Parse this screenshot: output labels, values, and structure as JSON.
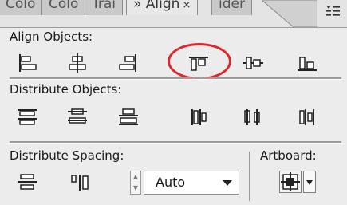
{
  "tabs": [
    {
      "label": "Colo"
    },
    {
      "label": "Colo"
    },
    {
      "label": "Trai"
    },
    {
      "label": "» Align",
      "close": "×",
      "active": true
    },
    {
      "label": "ider"
    }
  ],
  "panel_menu_icon": "panel-menu-icon",
  "align_objects": {
    "label": "Align Objects:",
    "buttons": [
      {
        "name": "horizontal-align-left"
      },
      {
        "name": "horizontal-align-center"
      },
      {
        "name": "horizontal-align-right"
      },
      {
        "name": "vertical-align-top",
        "highlighted": true
      },
      {
        "name": "vertical-align-center"
      },
      {
        "name": "vertical-align-bottom"
      }
    ]
  },
  "distribute_objects": {
    "label": "Distribute Objects:",
    "buttons": [
      {
        "name": "vertical-distribute-top"
      },
      {
        "name": "vertical-distribute-center"
      },
      {
        "name": "vertical-distribute-bottom"
      },
      {
        "name": "horizontal-distribute-left"
      },
      {
        "name": "horizontal-distribute-center"
      },
      {
        "name": "horizontal-distribute-right"
      }
    ]
  },
  "distribute_spacing": {
    "label": "Distribute Spacing:",
    "buttons": [
      {
        "name": "vertical-distribute-space"
      },
      {
        "name": "horizontal-distribute-space"
      }
    ],
    "value": "Auto"
  },
  "artboard": {
    "label": "Artboard:"
  },
  "colors": {
    "highlight_circle": "#e0262a",
    "panel_bg": "#ececec"
  }
}
